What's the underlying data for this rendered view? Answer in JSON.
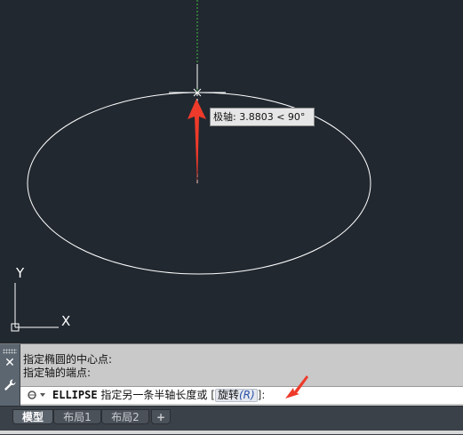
{
  "tooltip": {
    "text": "极轴: 3.8803 < 90°"
  },
  "ucs": {
    "y_label": "Y",
    "x_label": "X"
  },
  "command": {
    "history": [
      "指定椭圆的中心点:",
      "指定轴的端点:"
    ],
    "name": "ELLIPSE",
    "prompt": "指定另一条半轴长度或",
    "bracket_open": "[",
    "option_label": "旋转",
    "option_key": "(R)",
    "bracket_close": "]:"
  },
  "tabs": [
    {
      "label": "模型",
      "active": true
    },
    {
      "label": "布局1",
      "active": false
    },
    {
      "label": "布局2",
      "active": false
    },
    {
      "label": "+",
      "active": false
    }
  ],
  "colors": {
    "canvas": "#212830",
    "annotation_arrow": "#ee3a2a",
    "tracking_line": "#3fbf3f"
  },
  "icons": {
    "close": "close-icon",
    "customize": "wrench-icon",
    "prompt": "command-prompt-icon"
  }
}
